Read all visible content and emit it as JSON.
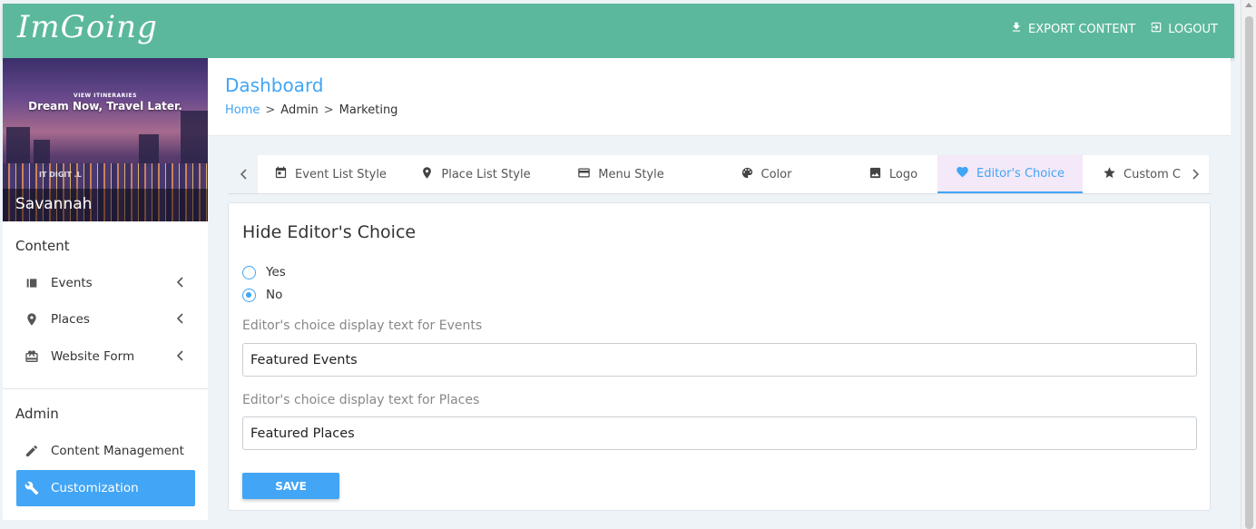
{
  "app": {
    "logo": "ImGoing"
  },
  "header": {
    "export_label": "EXPORT CONTENT",
    "logout_label": "LOGOUT"
  },
  "sidebar": {
    "hero": {
      "tagline": "VIEW ITINERARIES",
      "promo": "Dream Now, Travel Later.",
      "watermark": "IT DIGIT .L",
      "city": "Savannah"
    },
    "content_title": "Content",
    "content_items": [
      {
        "label": "Events",
        "icon": "events-icon"
      },
      {
        "label": "Places",
        "icon": "map-pin-icon"
      },
      {
        "label": "Website Form",
        "icon": "form-icon"
      }
    ],
    "admin_title": "Admin",
    "admin_items": [
      {
        "label": "Content Management",
        "icon": "pencil-icon"
      },
      {
        "label": "Customization",
        "icon": "wrench-icon",
        "active": true
      }
    ]
  },
  "dashboard": {
    "title": "Dashboard",
    "breadcrumb": {
      "home": "Home",
      "sep1": ">",
      "admin": "Admin",
      "sep2": ">",
      "current": "Marketing"
    }
  },
  "tabs": [
    {
      "label": "Event List Style",
      "icon": "calendar-icon"
    },
    {
      "label": "Place List Style",
      "icon": "map-pin-icon"
    },
    {
      "label": "Menu Style",
      "icon": "menu-card-icon"
    },
    {
      "label": "Color",
      "icon": "palette-icon"
    },
    {
      "label": "Logo",
      "icon": "image-icon"
    },
    {
      "label": "Editor's Choice",
      "icon": "heart-icon",
      "active": true
    },
    {
      "label": "Custom C",
      "icon": "star-icon"
    }
  ],
  "form": {
    "title": "Hide Editor's Choice",
    "options": {
      "yes": "Yes",
      "no": "No",
      "selected": "No"
    },
    "events_label": "Editor's choice display text for Events",
    "events_value": "Featured Events",
    "places_label": "Editor's choice display text for Places",
    "places_value": "Featured Places",
    "save_label": "SAVE"
  },
  "colors": {
    "header": "#5cb89d",
    "accent": "#42a5f5",
    "active_tab_bg": "#f3e9f8"
  }
}
